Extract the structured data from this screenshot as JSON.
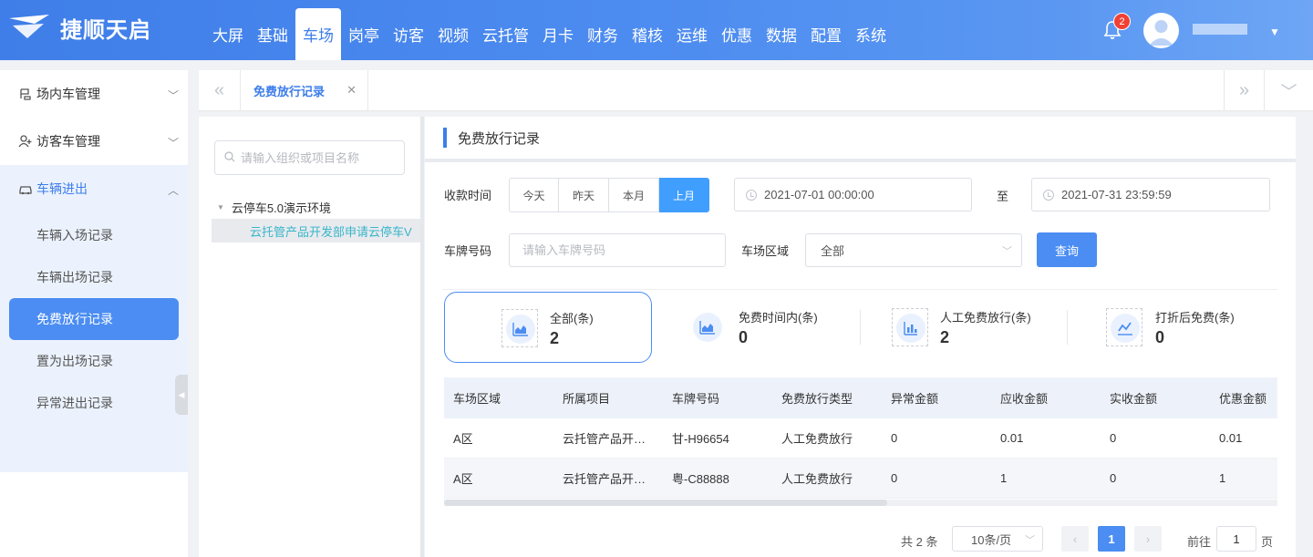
{
  "brand": {
    "name": "捷顺天启"
  },
  "nav": {
    "items": [
      "大屏",
      "基础",
      "车场",
      "岗亭",
      "访客",
      "视频",
      "云托管",
      "月卡",
      "财务",
      "稽核",
      "运维",
      "优惠",
      "数据",
      "配置",
      "系统"
    ],
    "active": "车场"
  },
  "header": {
    "notification_count": "2"
  },
  "sidebar": {
    "groups": [
      {
        "label": "场内车管理",
        "icon": "parking-icon"
      },
      {
        "label": "访客车管理",
        "icon": "visitor-icon"
      },
      {
        "label": "车辆进出",
        "icon": "car-icon"
      }
    ],
    "subitems": [
      "车辆入场记录",
      "车辆出场记录",
      "免费放行记录",
      "置为出场记录",
      "异常进出记录"
    ],
    "active_subitem": "免费放行记录"
  },
  "tabs": {
    "items": [
      {
        "label": "免费放行记录"
      }
    ]
  },
  "tree": {
    "search_placeholder": "请输入组织或项目名称",
    "root": "云停车5.0演示环境",
    "child": "云托管产品开发部申请云停车V"
  },
  "page": {
    "title": "免费放行记录"
  },
  "filters": {
    "time_label": "收款时间",
    "quick_ranges": [
      "今天",
      "昨天",
      "本月",
      "上月"
    ],
    "active_range": "上月",
    "start": "2021-07-01 00:00:00",
    "to_label": "至",
    "end": "2021-07-31 23:59:59",
    "plate_label": "车牌号码",
    "plate_placeholder": "请输入车牌号码",
    "area_label": "车场区域",
    "area_value": "全部",
    "query_label": "查询"
  },
  "stats": [
    {
      "label": "全部(条)",
      "value": "2",
      "icon": "area-chart-icon"
    },
    {
      "label": "免费时间内(条)",
      "value": "0",
      "icon": "area-chart-icon"
    },
    {
      "label": "人工免费放行(条)",
      "value": "2",
      "icon": "bar-chart-icon"
    },
    {
      "label": "打折后免费(条)",
      "value": "0",
      "icon": "line-chart-icon"
    }
  ],
  "table": {
    "columns": [
      "车场区域",
      "所属项目",
      "车牌号码",
      "免费放行类型",
      "异常金额",
      "应收金额",
      "实收金额",
      "优惠金额"
    ],
    "rows": [
      [
        "A区",
        "云托管产品开发部申请云停车V",
        "甘-H96654",
        "人工免费放行",
        "0",
        "0.01",
        "0",
        "0.01"
      ],
      [
        "A区",
        "云托管产品开发部申请云停车V",
        "粤-C88888",
        "人工免费放行",
        "0",
        "1",
        "0",
        "1"
      ]
    ]
  },
  "pagination": {
    "total": "共 2 条",
    "page_size": "10条/页",
    "current": "1",
    "goto_label": "前往",
    "goto_value": "1",
    "page_suffix": "页"
  },
  "colors": {
    "primary": "#4b8df2",
    "topbar": "#4d8cf0",
    "badge": "#f04134"
  }
}
